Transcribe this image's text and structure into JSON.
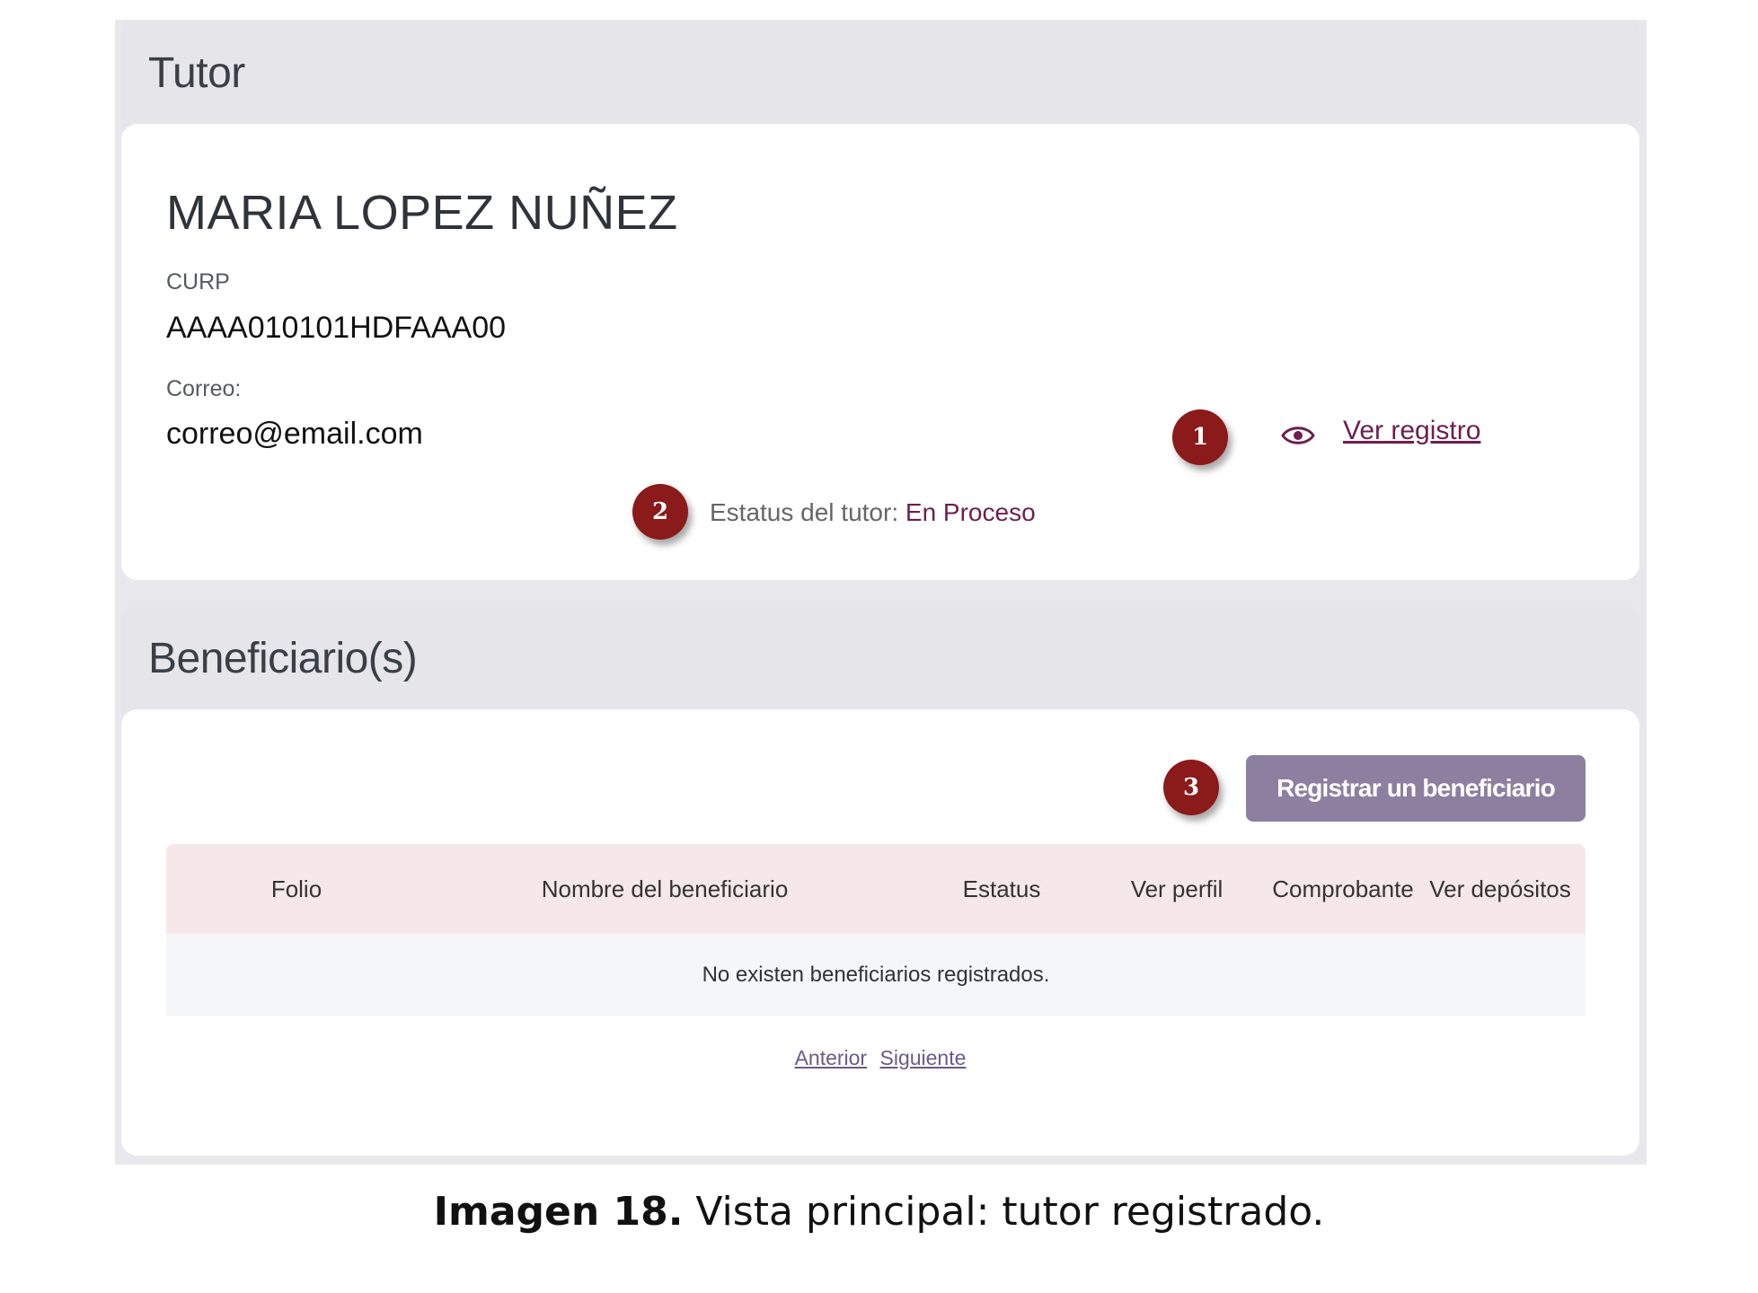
{
  "tutor_section": {
    "title": "Tutor",
    "name": "MARIA LOPEZ NUÑEZ",
    "curp_label": "CURP",
    "curp_value": "AAAA010101HDFAAA00",
    "email_label": "Correo:",
    "email_value": "correo@email.com",
    "view_record_link": "Ver registro",
    "status_label": "Estatus del tutor:",
    "status_value": "En Proceso"
  },
  "beneficiaries_section": {
    "title": "Beneficiario(s)",
    "register_button": "Registrar un beneficiario",
    "table": {
      "columns": [
        "Folio",
        "Nombre del beneficiario",
        "Estatus",
        "Ver perfil",
        "Comprobante",
        "Ver depósitos"
      ],
      "empty_message": "No existen beneficiarios registrados."
    },
    "pagination": {
      "prev": "Anterior",
      "next": "Siguiente"
    }
  },
  "markers": [
    "1",
    "2",
    "3"
  ],
  "caption": {
    "bold": "Imagen 18.",
    "text": " Vista principal: tutor registrado."
  },
  "colors": {
    "accent": "#6d1f4f",
    "marker": "#8b1a1a",
    "button": "#8d7fa0",
    "table_header": "#f6e8e8"
  },
  "icons": {
    "view": "eye-icon"
  }
}
